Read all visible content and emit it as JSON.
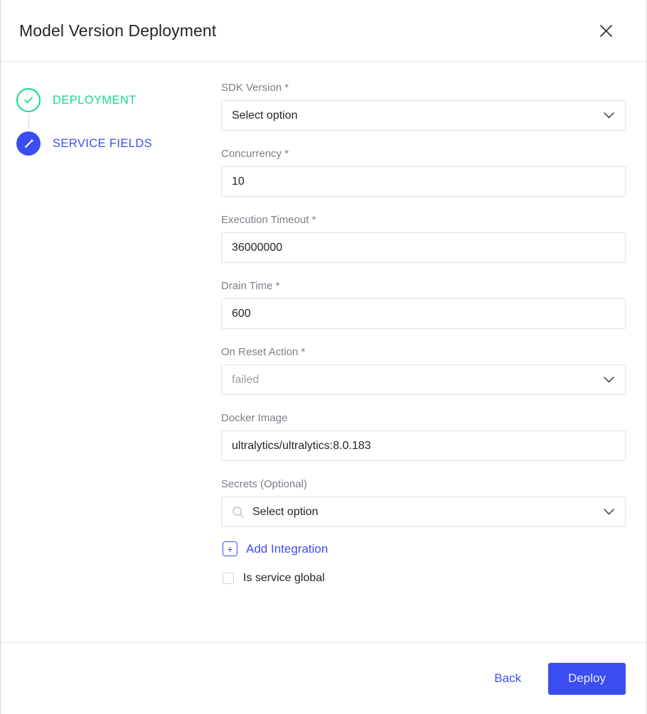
{
  "dialog": {
    "title": "Model Version Deployment",
    "close_icon": "close-icon"
  },
  "stepper": {
    "steps": [
      {
        "label": "DEPLOYMENT",
        "state": "completed",
        "icon": "check-circle-icon"
      },
      {
        "label": "SERVICE FIELDS",
        "state": "active",
        "icon": "pencil-circle-icon"
      }
    ]
  },
  "form": {
    "fields": [
      {
        "label": "SDK Version *",
        "type": "select",
        "value": "Select option",
        "muted": false,
        "icon": "chevron-down-icon"
      },
      {
        "label": "Concurrency *",
        "type": "text",
        "value": "10",
        "muted": false
      },
      {
        "label": "Execution Timeout *",
        "type": "text",
        "value": "36000000",
        "muted": false
      },
      {
        "label": "Drain Time *",
        "type": "text",
        "value": "600",
        "muted": false
      },
      {
        "label": "On Reset Action *",
        "type": "select",
        "value": "failed",
        "muted": true,
        "icon": "chevron-down-icon"
      },
      {
        "label": "Docker Image",
        "type": "text",
        "value": "ultralytics/ultralytics:8.0.183",
        "muted": false
      },
      {
        "label": "Secrets (Optional)",
        "type": "search-select",
        "value": "Select option",
        "muted": false,
        "icon": "search-icon",
        "trailing_icon": "chevron-down-icon"
      }
    ],
    "add_integration": {
      "label": "Add Integration",
      "icon": "plus-box-icon"
    },
    "checkbox": {
      "label": "Is service global",
      "checked": false
    }
  },
  "footer": {
    "back_label": "Back",
    "deploy_label": "Deploy"
  },
  "colors": {
    "accent_blue": "#3b4df0",
    "success_green": "#14d989",
    "label_gray": "#7b7f87",
    "border_gray": "#e2e2e4"
  }
}
